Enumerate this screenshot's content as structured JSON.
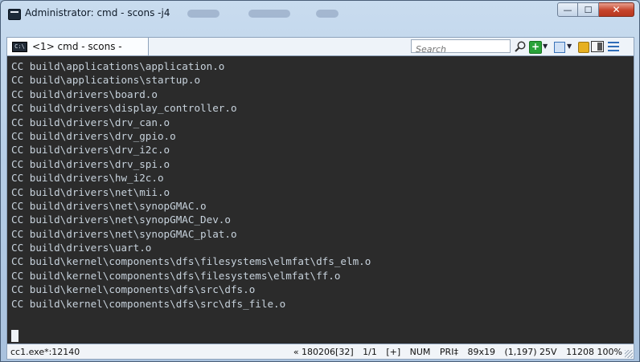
{
  "window": {
    "title": "Administrator: cmd - scons  -j4",
    "controls": {
      "minimize": "—",
      "maximize": "☐",
      "close": "✕"
    }
  },
  "tabs": [
    {
      "label": "<1> cmd - scons  -"
    }
  ],
  "search": {
    "placeholder": "Search"
  },
  "toolbar_icons": [
    "search-icon",
    "add-console-icon",
    "dropdown-icon",
    "panel-icon",
    "dropdown-icon",
    "lock-icon",
    "layout-icon",
    "menu-icon"
  ],
  "console": {
    "lines": [
      "CC build\\applications\\application.o",
      "CC build\\applications\\startup.o",
      "CC build\\drivers\\board.o",
      "CC build\\drivers\\display_controller.o",
      "CC build\\drivers\\drv_can.o",
      "CC build\\drivers\\drv_gpio.o",
      "CC build\\drivers\\drv_i2c.o",
      "CC build\\drivers\\drv_spi.o",
      "CC build\\drivers\\hw_i2c.o",
      "CC build\\drivers\\net\\mii.o",
      "CC build\\drivers\\net\\synopGMAC.o",
      "CC build\\drivers\\net\\synopGMAC_Dev.o",
      "CC build\\drivers\\net\\synopGMAC_plat.o",
      "CC build\\drivers\\uart.o",
      "CC build\\kernel\\components\\dfs\\filesystems\\elmfat\\dfs_elm.o",
      "CC build\\kernel\\components\\dfs\\filesystems\\elmfat\\ff.o",
      "CC build\\kernel\\components\\dfs\\src\\dfs.o",
      "CC build\\kernel\\components\\dfs\\src\\dfs_file.o"
    ]
  },
  "status": {
    "process": "cc1.exe*:12140",
    "position": "« 180206[32]",
    "page": "1/1",
    "plus": "[+]",
    "numlock": "NUM",
    "priority": "PRI‡",
    "size": "89x19",
    "cursor": "(1,197) 25V",
    "pid_zoom": "11208 100%"
  },
  "colors": {
    "console_bg": "#2b2b2b",
    "console_text": "#c7d2dc",
    "close_button": "#c5432a"
  }
}
